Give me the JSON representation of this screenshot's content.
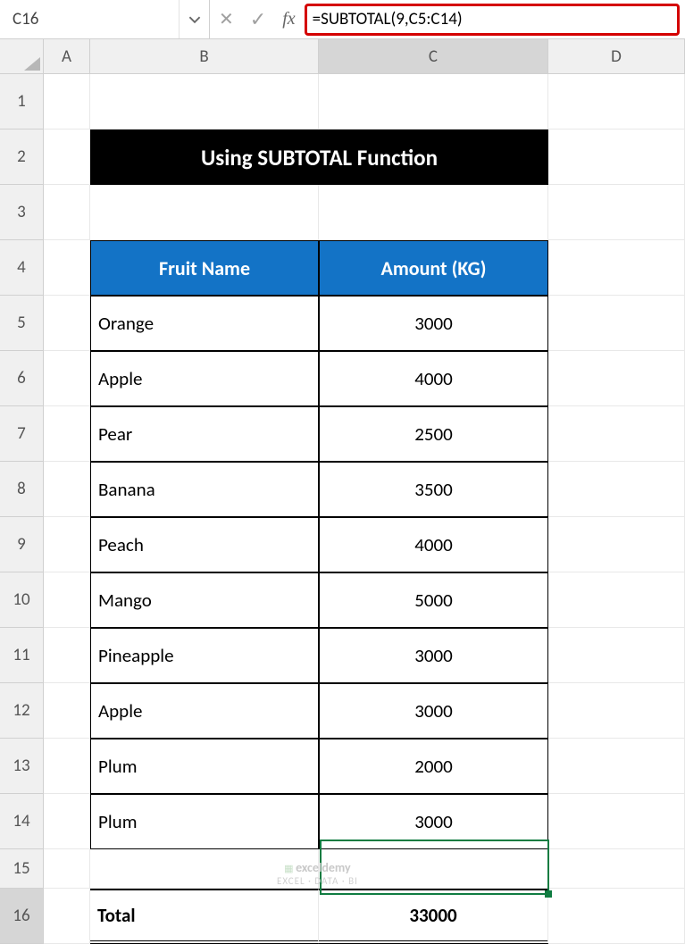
{
  "name_box": "C16",
  "formula": "=SUBTOTAL(9,C5:C14)",
  "columns": [
    "A",
    "B",
    "C",
    "D"
  ],
  "title": "Using SUBTOTAL Function",
  "headers": {
    "fruit": "Fruit Name",
    "amount": "Amount (KG)"
  },
  "rows": [
    {
      "fruit": "Orange",
      "amount": "3000"
    },
    {
      "fruit": "Apple",
      "amount": "4000"
    },
    {
      "fruit": "Pear",
      "amount": "2500"
    },
    {
      "fruit": "Banana",
      "amount": "3500"
    },
    {
      "fruit": "Peach",
      "amount": "4000"
    },
    {
      "fruit": "Mango",
      "amount": "5000"
    },
    {
      "fruit": "Pineapple",
      "amount": "3000"
    },
    {
      "fruit": "Apple",
      "amount": "3000"
    },
    {
      "fruit": "Plum",
      "amount": "2000"
    },
    {
      "fruit": "Plum",
      "amount": "3000"
    }
  ],
  "total": {
    "label": "Total",
    "value": "33000"
  },
  "row_labels": [
    "1",
    "2",
    "3",
    "4",
    "5",
    "6",
    "7",
    "8",
    "9",
    "10",
    "11",
    "12",
    "13",
    "14",
    "15",
    "16"
  ],
  "watermark": {
    "brand": "exceldemy",
    "tag": "EXCEL · DATA · BI"
  },
  "chart_data": {
    "type": "table",
    "title": "Using SUBTOTAL Function",
    "columns": [
      "Fruit Name",
      "Amount (KG)"
    ],
    "rows": [
      [
        "Orange",
        3000
      ],
      [
        "Apple",
        4000
      ],
      [
        "Pear",
        2500
      ],
      [
        "Banana",
        3500
      ],
      [
        "Peach",
        4000
      ],
      [
        "Mango",
        5000
      ],
      [
        "Pineapple",
        3000
      ],
      [
        "Apple",
        3000
      ],
      [
        "Plum",
        2000
      ],
      [
        "Plum",
        3000
      ]
    ],
    "total": 33000
  }
}
